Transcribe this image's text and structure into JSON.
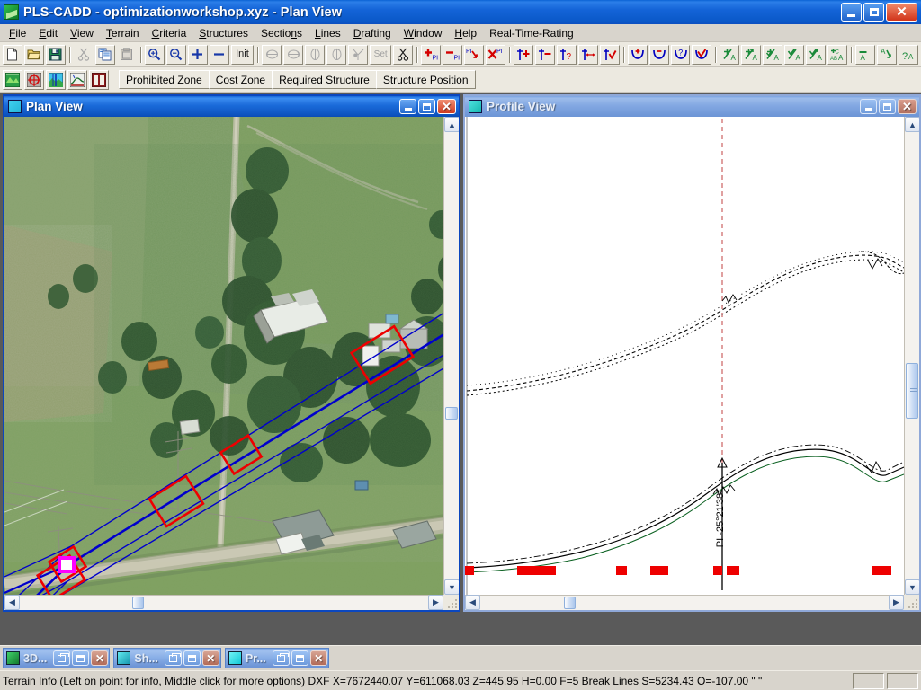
{
  "window": {
    "title": "PLS-CADD - optimizationworkshop.xyz - Plan View",
    "app_icon": "pls-cadd-icon",
    "minimize_label": "Minimize",
    "maximize_label": "Maximize",
    "close_label": "Close"
  },
  "menubar": {
    "items": [
      {
        "label": "File",
        "accel": "F"
      },
      {
        "label": "Edit",
        "accel": "E"
      },
      {
        "label": "View",
        "accel": "V"
      },
      {
        "label": "Terrain",
        "accel": "T"
      },
      {
        "label": "Criteria",
        "accel": "C"
      },
      {
        "label": "Structures",
        "accel": "S"
      },
      {
        "label": "Sections",
        "accel": "n"
      },
      {
        "label": "Lines",
        "accel": "L"
      },
      {
        "label": "Drafting",
        "accel": "D"
      },
      {
        "label": "Window",
        "accel": "W"
      },
      {
        "label": "Help",
        "accel": "H"
      },
      {
        "label": "Real-Time-Rating",
        "accel": ""
      }
    ]
  },
  "toolbar_main": {
    "groups": [
      {
        "name": "file-group",
        "buttons": [
          {
            "name": "new-file-icon",
            "tooltip": "New",
            "enabled": true
          },
          {
            "name": "open-file-icon",
            "tooltip": "Open",
            "enabled": true
          },
          {
            "name": "save-file-icon",
            "tooltip": "Save",
            "enabled": true
          }
        ]
      },
      {
        "name": "clipboard-group",
        "buttons": [
          {
            "name": "cut-icon",
            "tooltip": "Cut",
            "enabled": false
          },
          {
            "name": "copy-icon",
            "tooltip": "Copy",
            "enabled": true
          },
          {
            "name": "paste-icon",
            "tooltip": "Paste",
            "enabled": false
          }
        ]
      },
      {
        "name": "zoom-group",
        "buttons": [
          {
            "name": "zoom-in-icon",
            "tooltip": "Zoom In",
            "enabled": true
          },
          {
            "name": "zoom-out-icon",
            "tooltip": "Zoom Out",
            "enabled": true
          },
          {
            "name": "plus-icon",
            "tooltip": "Increase",
            "enabled": true
          },
          {
            "name": "minus-icon",
            "tooltip": "Decrease",
            "enabled": true
          },
          {
            "name": "init-button",
            "label": "Init",
            "tooltip": "Initial View",
            "enabled": true
          }
        ]
      },
      {
        "name": "rotate-group",
        "buttons": [
          {
            "name": "rotate-left-icon",
            "tooltip": "Rotate Left",
            "enabled": false
          },
          {
            "name": "rotate-right-icon",
            "tooltip": "Rotate Right",
            "enabled": false
          },
          {
            "name": "flip-vertical-icon",
            "tooltip": "Flip Vertical",
            "enabled": false
          },
          {
            "name": "flip-horizontal-icon",
            "tooltip": "Flip Horizontal",
            "enabled": false
          },
          {
            "name": "pick-point-icon",
            "tooltip": "Pick Point",
            "enabled": false
          },
          {
            "name": "set-button",
            "label": "Set",
            "tooltip": "Set",
            "enabled": false
          },
          {
            "name": "scissors-icon",
            "tooltip": "Cut Section",
            "enabled": true
          }
        ]
      },
      {
        "name": "pi-group",
        "buttons": [
          {
            "name": "add-pi-icon",
            "tooltip": "Add PI",
            "enabled": true
          },
          {
            "name": "remove-pi-icon",
            "tooltip": "Remove PI",
            "enabled": true
          },
          {
            "name": "move-pi-icon",
            "tooltip": "Move PI",
            "enabled": true
          },
          {
            "name": "delete-pi-icon",
            "tooltip": "Delete PI",
            "enabled": true
          }
        ]
      },
      {
        "name": "structure-group",
        "buttons": [
          {
            "name": "add-structure-icon",
            "tooltip": "Add Structure",
            "enabled": true
          },
          {
            "name": "remove-structure-icon",
            "tooltip": "Remove Structure",
            "enabled": true
          },
          {
            "name": "query-structure-icon",
            "tooltip": "Query Structure",
            "enabled": true
          },
          {
            "name": "move-structure-icon",
            "tooltip": "Move Structure",
            "enabled": true
          },
          {
            "name": "check-structure-icon",
            "tooltip": "Check Structure",
            "enabled": true
          }
        ]
      },
      {
        "name": "cable-group",
        "buttons": [
          {
            "name": "add-cable-icon",
            "tooltip": "Add Cable",
            "enabled": true
          },
          {
            "name": "remove-cable-icon",
            "tooltip": "Remove Cable",
            "enabled": true
          },
          {
            "name": "query-cable-icon",
            "tooltip": "Query Cable",
            "enabled": true
          },
          {
            "name": "check-cable-icon",
            "tooltip": "Check Cable",
            "enabled": true
          }
        ]
      },
      {
        "name": "annotation-group",
        "buttons": [
          {
            "name": "add-annotation-icon",
            "tooltip": "Add Annotation",
            "enabled": true
          },
          {
            "name": "move-annotation-icon",
            "tooltip": "Move Annotation",
            "enabled": true
          },
          {
            "name": "edit-annotation-icon",
            "tooltip": "Edit Annotation",
            "enabled": true
          },
          {
            "name": "check-annotation-icon",
            "tooltip": "Check Annotation",
            "enabled": true
          },
          {
            "name": "insert-annotation-icon",
            "tooltip": "Insert Annotation",
            "enabled": true
          },
          {
            "name": "abc-annotation-icon",
            "tooltip": "Text Annotation",
            "enabled": true
          }
        ]
      },
      {
        "name": "annotation-del-group",
        "buttons": [
          {
            "name": "delete-annotation-icon",
            "tooltip": "Delete Annotation",
            "enabled": true
          },
          {
            "name": "move-label-icon",
            "tooltip": "Move Label",
            "enabled": true
          },
          {
            "name": "query-label-icon",
            "tooltip": "Query Label",
            "enabled": true
          }
        ]
      }
    ]
  },
  "toolbar_optimization": {
    "icon_buttons": [
      {
        "name": "terrain-model-icon",
        "tooltip": "Terrain Model"
      },
      {
        "name": "optimization-icon",
        "tooltip": "Optimization"
      },
      {
        "name": "plan-view-icon",
        "tooltip": "Plan View"
      },
      {
        "name": "profile-view-icon",
        "tooltip": "Profile View"
      },
      {
        "name": "sheet-view-icon",
        "tooltip": "Sheet View"
      }
    ],
    "tabs": [
      {
        "label": "Prohibited Zone"
      },
      {
        "label": "Cost Zone"
      },
      {
        "label": "Required Structure"
      },
      {
        "label": "Structure Position"
      }
    ]
  },
  "plan_view": {
    "title": "Plan View",
    "icon": "plan-view-icon",
    "active": true,
    "scroll_h_position_pct": 30,
    "scroll_v_position_pct": 62
  },
  "profile_view": {
    "title": "Profile View",
    "icon": "profile-view-icon",
    "active": false,
    "pi_label": "PI -25°21'38\"",
    "scroll_h_position_pct": 22,
    "scroll_v_position_pct": 58
  },
  "taskbar": {
    "items": [
      {
        "label": "3D...",
        "icon": "3d-view-icon",
        "icon_color": "#1f9c38"
      },
      {
        "label": "Sh...",
        "icon": "sheet-view-icon",
        "icon_color": "#2ecfe0"
      },
      {
        "label": "Pr...",
        "icon": "profile-view-icon",
        "icon_color": "#20e0e8"
      }
    ],
    "restore_label": "Restore",
    "maximize_label": "Maximize",
    "close_label": "Close"
  },
  "statusbar": {
    "message": "Terrain Info (Left on point for info, Middle click for more options) DXF X=7672440.07 Y=611068.03 Z=445.95 H=0.00 F=5 Break Lines S=5234.43 O=-107.00 \" \""
  },
  "colors": {
    "title_blue": "#0b57c8",
    "inactive_title_blue": "#83a8e2",
    "face": "#d8d4cc",
    "toolbar_face": "#ece9e0",
    "structure_red": "#ee0000",
    "line_blue": "#0000cc",
    "selected_magenta": "#ff00ff",
    "pi_dash_red": "#c04040"
  }
}
